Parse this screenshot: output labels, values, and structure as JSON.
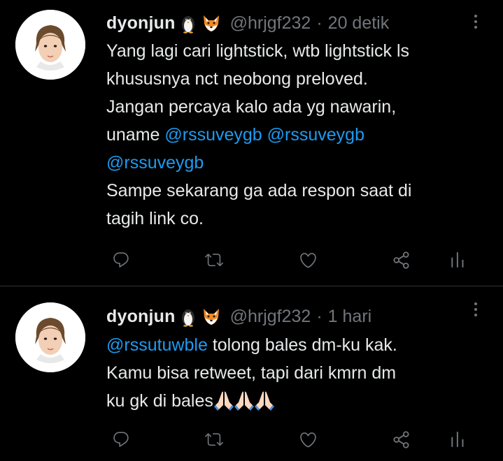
{
  "tweets": [
    {
      "display_name": "dyonjun",
      "emojis": [
        "penguin-icon",
        "fox-icon"
      ],
      "handle": "@hrjgf232",
      "separator": "·",
      "time": "20 detik",
      "lines": [
        {
          "text": "Yang lagi cari lightstick, wtb lightstick ls"
        },
        {
          "text": "khususnya nct neobong preloved."
        },
        {
          "text": "Jangan percaya kalo ada yg nawarin,"
        },
        {
          "prefix": "uname ",
          "mention1": "@rssuveygb",
          "mention2": "@rssuveygb"
        },
        {
          "mention": "@rssuveygb"
        },
        {
          "text": "Sampe sekarang ga ada respon saat di"
        },
        {
          "text": "tagih link co."
        }
      ],
      "actions": [
        "reply-icon",
        "retweet-icon",
        "like-icon",
        "share-icon",
        "analytics-icon"
      ]
    },
    {
      "display_name": "dyonjun",
      "emojis": [
        "penguin-icon",
        "fox-icon"
      ],
      "handle": "@hrjgf232",
      "separator": "·",
      "time": "1 hari",
      "lines": [
        {
          "mention": "@rssutuwble",
          "suffix": " tolong bales dm-ku kak."
        },
        {
          "text": "Kamu bisa retweet, tapi dari kmrn dm"
        },
        {
          "text": "ku gk di bales",
          "trailing_emojis": [
            "folded-hands-icon",
            "folded-hands-icon",
            "folded-hands-icon"
          ]
        }
      ],
      "actions": [
        "reply-icon",
        "retweet-icon",
        "like-icon",
        "share-icon",
        "analytics-icon"
      ]
    }
  ],
  "colors": {
    "background": "#000000",
    "text": "#e7e9ea",
    "muted": "#71767b",
    "link": "#1d9bf0",
    "divider": "#2f3336"
  }
}
